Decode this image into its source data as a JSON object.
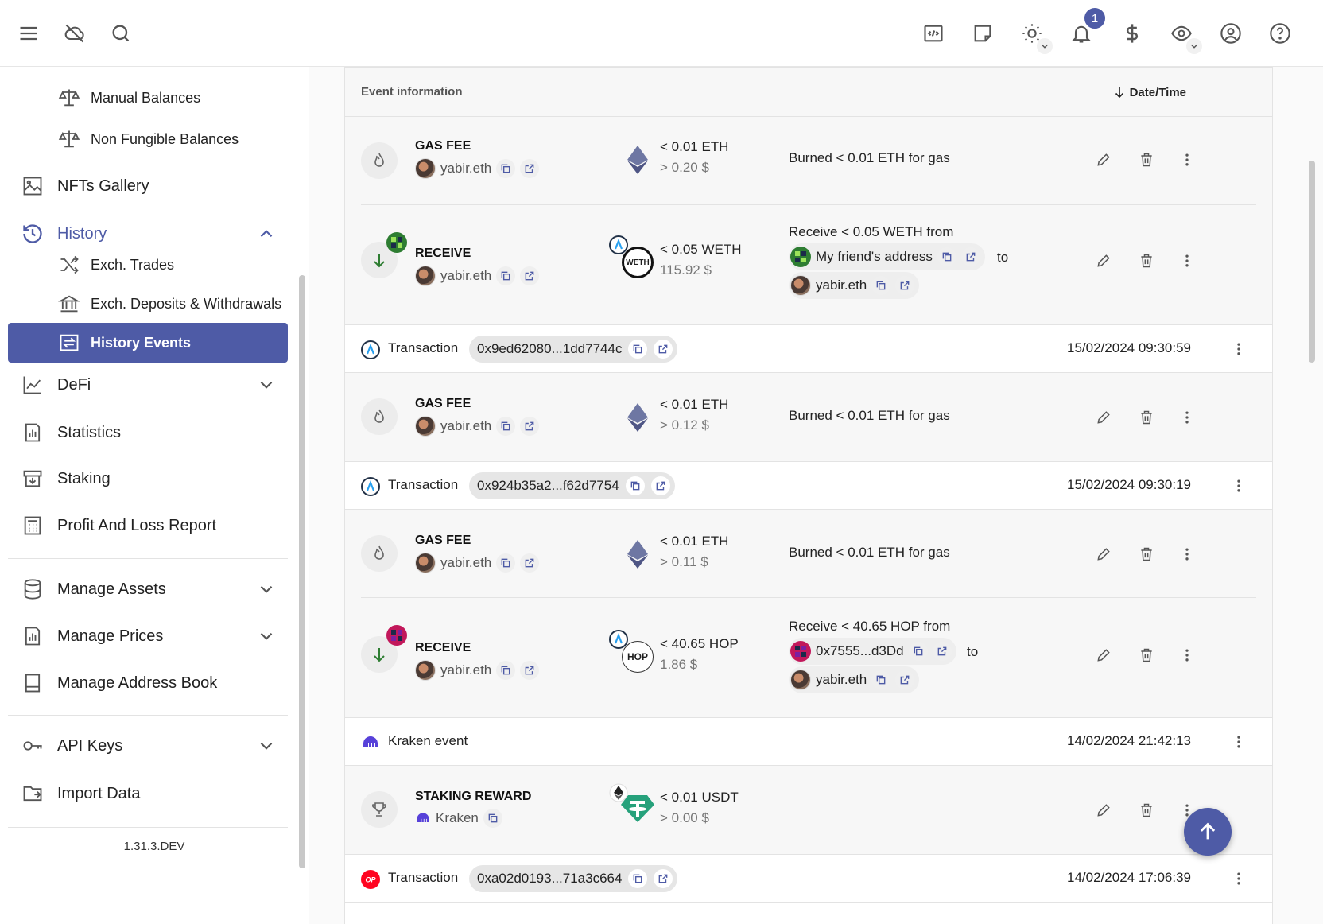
{
  "topbar": {
    "notification_count": "1"
  },
  "sidebar": {
    "manual_balances": "Manual Balances",
    "non_fungible_balances": "Non Fungible Balances",
    "nfts_gallery": "NFTs Gallery",
    "history": "History",
    "exch_trades": "Exch. Trades",
    "exch_deposits": "Exch. Deposits & Withdrawals",
    "history_events": "History Events",
    "defi": "DeFi",
    "statistics": "Statistics",
    "staking": "Staking",
    "profit_loss": "Profit And Loss Report",
    "manage_assets": "Manage Assets",
    "manage_prices": "Manage Prices",
    "manage_address_book": "Manage Address Book",
    "api_keys": "API Keys",
    "import_data": "Import Data",
    "version": "1.31.3.DEV"
  },
  "table": {
    "col_event_info": "Event information",
    "col_datetime": "Date/Time"
  },
  "events": {
    "e1": {
      "type": "GAS FEE",
      "account": "yabir.eth",
      "amount": "< 0.01 ETH",
      "value": "> 0.20 $",
      "desc": "Burned < 0.01 ETH for gas"
    },
    "e2": {
      "type": "RECEIVE",
      "account": "yabir.eth",
      "amount": "< 0.05 WETH",
      "value": "115.92 $",
      "desc": "Receive < 0.05 WETH from",
      "from": "My friend's address",
      "to_word": "to",
      "to": "yabir.eth",
      "asset_label": "WETH"
    },
    "tx1": {
      "label": "Transaction",
      "hash": "0x9ed62080...1dd7744c",
      "date": "15/02/2024 09:30:59"
    },
    "e3": {
      "type": "GAS FEE",
      "account": "yabir.eth",
      "amount": "< 0.01 ETH",
      "value": "> 0.12 $",
      "desc": "Burned < 0.01 ETH for gas"
    },
    "tx2": {
      "label": "Transaction",
      "hash": "0x924b35a2...f62d7754",
      "date": "15/02/2024 09:30:19"
    },
    "e4": {
      "type": "GAS FEE",
      "account": "yabir.eth",
      "amount": "< 0.01 ETH",
      "value": "> 0.11 $",
      "desc": "Burned < 0.01 ETH for gas"
    },
    "e5": {
      "type": "RECEIVE",
      "account": "yabir.eth",
      "amount": "< 40.65 HOP",
      "value": "1.86 $",
      "desc": "Receive < 40.65 HOP from",
      "from": "0x7555...d3Dd",
      "to_word": "to",
      "to": "yabir.eth",
      "asset_label": "HOP"
    },
    "tx3": {
      "label": "Kraken event",
      "date": "14/02/2024 21:42:13"
    },
    "e6": {
      "type": "STAKING REWARD",
      "account": "Kraken",
      "amount": "< 0.01 USDT",
      "value": "> 0.00 $"
    },
    "tx4": {
      "label": "Transaction",
      "hash": "0xa02d0193...71a3c664",
      "date": "14/02/2024 17:06:39",
      "chain_badge": "OP"
    }
  },
  "colors": {
    "accent": "#4e5ba6"
  }
}
